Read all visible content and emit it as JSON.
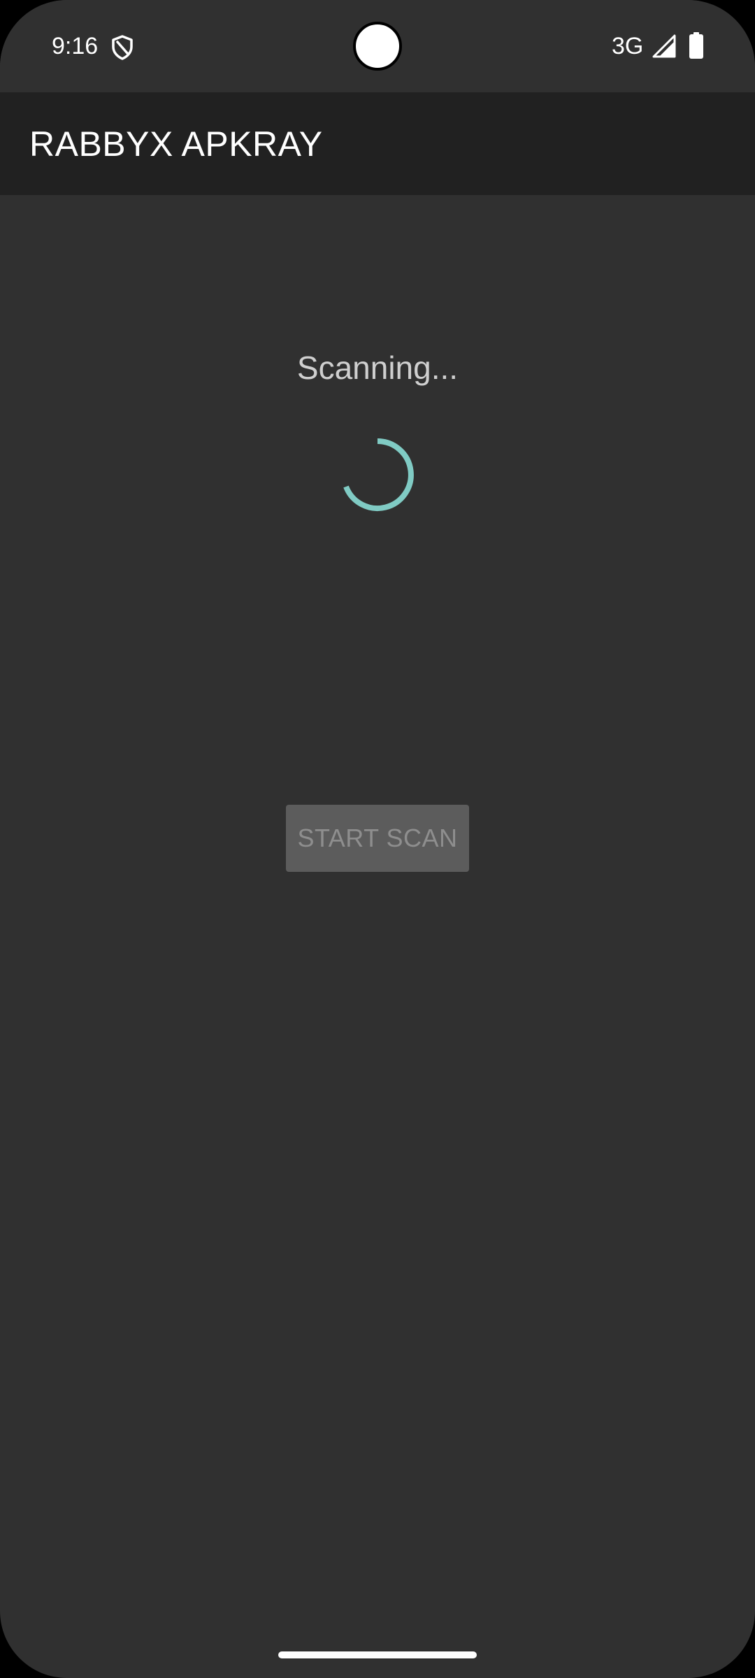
{
  "status_bar": {
    "time": "9:16",
    "network": "3G",
    "icons": [
      "shield-icon",
      "signal-icon",
      "battery-icon"
    ]
  },
  "app_bar": {
    "title": "RABBYX APKRAY"
  },
  "main": {
    "status_text": "Scanning...",
    "start_button_label": "START SCAN",
    "start_button_enabled": false
  },
  "colors": {
    "background": "#303030",
    "app_bar": "#212121",
    "spinner": "#80cbc4",
    "button_disabled": "#5c5c5c",
    "button_text_disabled": "#8e8e8e"
  }
}
